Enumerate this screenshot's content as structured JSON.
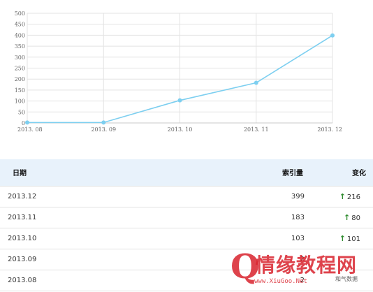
{
  "chart_data": {
    "type": "line",
    "categories": [
      "2013. 08",
      "2013. 09",
      "2013. 10",
      "2013. 11",
      "2013. 12"
    ],
    "series": [
      {
        "values": [
          2,
          2,
          103,
          183,
          399
        ]
      }
    ],
    "yticks": [
      "0",
      "50",
      "100",
      "150",
      "200",
      "250",
      "300",
      "350",
      "400",
      "450",
      "500"
    ],
    "ylim": [
      0,
      500
    ],
    "grid": true,
    "color": "#7dcff0"
  },
  "table": {
    "headers": {
      "date": "日期",
      "index": "索引量",
      "change": "变化"
    },
    "rows": [
      {
        "date": "2013.12",
        "index": "399",
        "change": "216",
        "arrow": "↑"
      },
      {
        "date": "2013.11",
        "index": "183",
        "change": "80",
        "arrow": "↑"
      },
      {
        "date": "2013.10",
        "index": "103",
        "change": "101",
        "arrow": "↑"
      },
      {
        "date": "2013.09",
        "index": "2",
        "change": "",
        "arrow": ""
      },
      {
        "date": "2013.08",
        "index": "2",
        "change": "",
        "arrow": ""
      }
    ],
    "arrow_color": "#2e8b2e"
  },
  "watermark": {
    "mark": "Q",
    "text": "情缘教程网",
    "url": "www.XiuGoo.Net",
    "extra": "和气数据"
  }
}
